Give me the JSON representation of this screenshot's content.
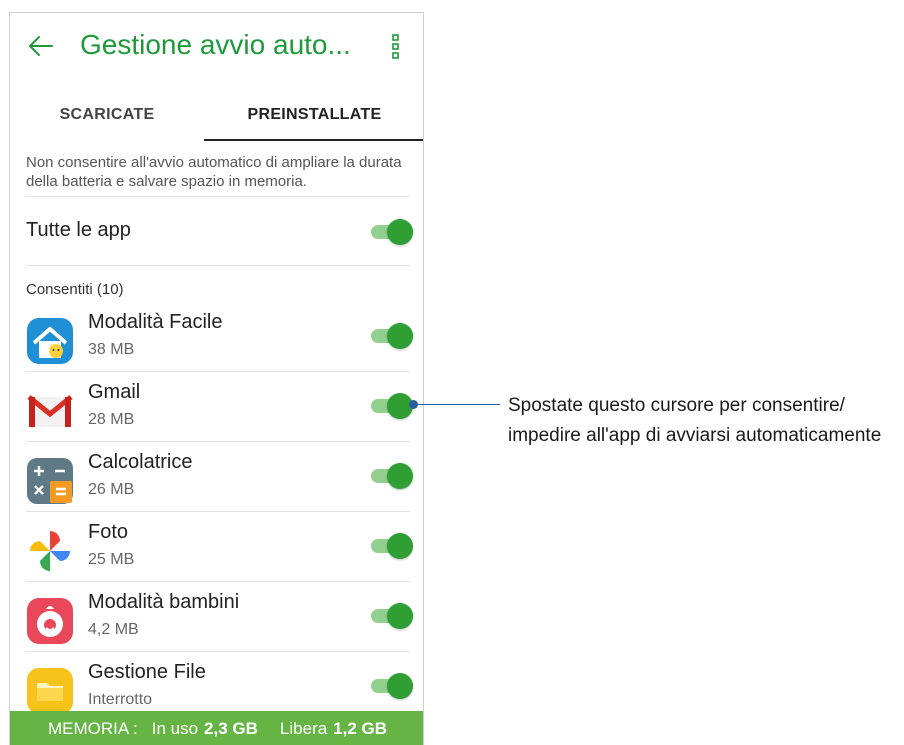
{
  "appbar": {
    "title": "Gestione avvio auto..."
  },
  "tabs": [
    {
      "label": "SCARICATE",
      "selected": false
    },
    {
      "label": "PREINSTALLATE",
      "selected": true
    }
  ],
  "description": "Non consentire all'avvio automatico di ampliare la durata della batteria e salvare spazio in memoria.",
  "all_apps": {
    "label": "Tutte le app",
    "enabled": true
  },
  "section": {
    "label": "Consentiti (10)"
  },
  "apps": [
    {
      "name": "Modalità Facile",
      "size": "38 MB",
      "icon": "easy-mode-icon",
      "enabled": true
    },
    {
      "name": "Gmail",
      "size": "28 MB",
      "icon": "gmail-icon",
      "enabled": true
    },
    {
      "name": "Calcolatrice",
      "size": "26 MB",
      "icon": "calculator-icon",
      "enabled": true
    },
    {
      "name": "Foto",
      "size": "25 MB",
      "icon": "photos-icon",
      "enabled": true
    },
    {
      "name": "Modalità bambini",
      "size": "4,2 MB",
      "icon": "kids-mode-icon",
      "enabled": true
    },
    {
      "name": "Gestione File",
      "size": "Interrotto",
      "icon": "file-manager-icon",
      "enabled": true
    }
  ],
  "footer": {
    "memory_label": "MEMORIA :",
    "used_label": "In uso",
    "used_value": "2,3 GB",
    "free_label": "Libera",
    "free_value": "1,2 GB"
  },
  "callout": {
    "line1": "Spostate questo cursore per consentire/",
    "line2": "impedire all'app di avviarsi automaticamente"
  },
  "colors": {
    "accent": "#1e9a3c",
    "toggle_thumb": "#2f9e33",
    "toggle_track": "#93cf8f",
    "footer_bg": "#65b444",
    "callout": "#2a5f9e"
  }
}
